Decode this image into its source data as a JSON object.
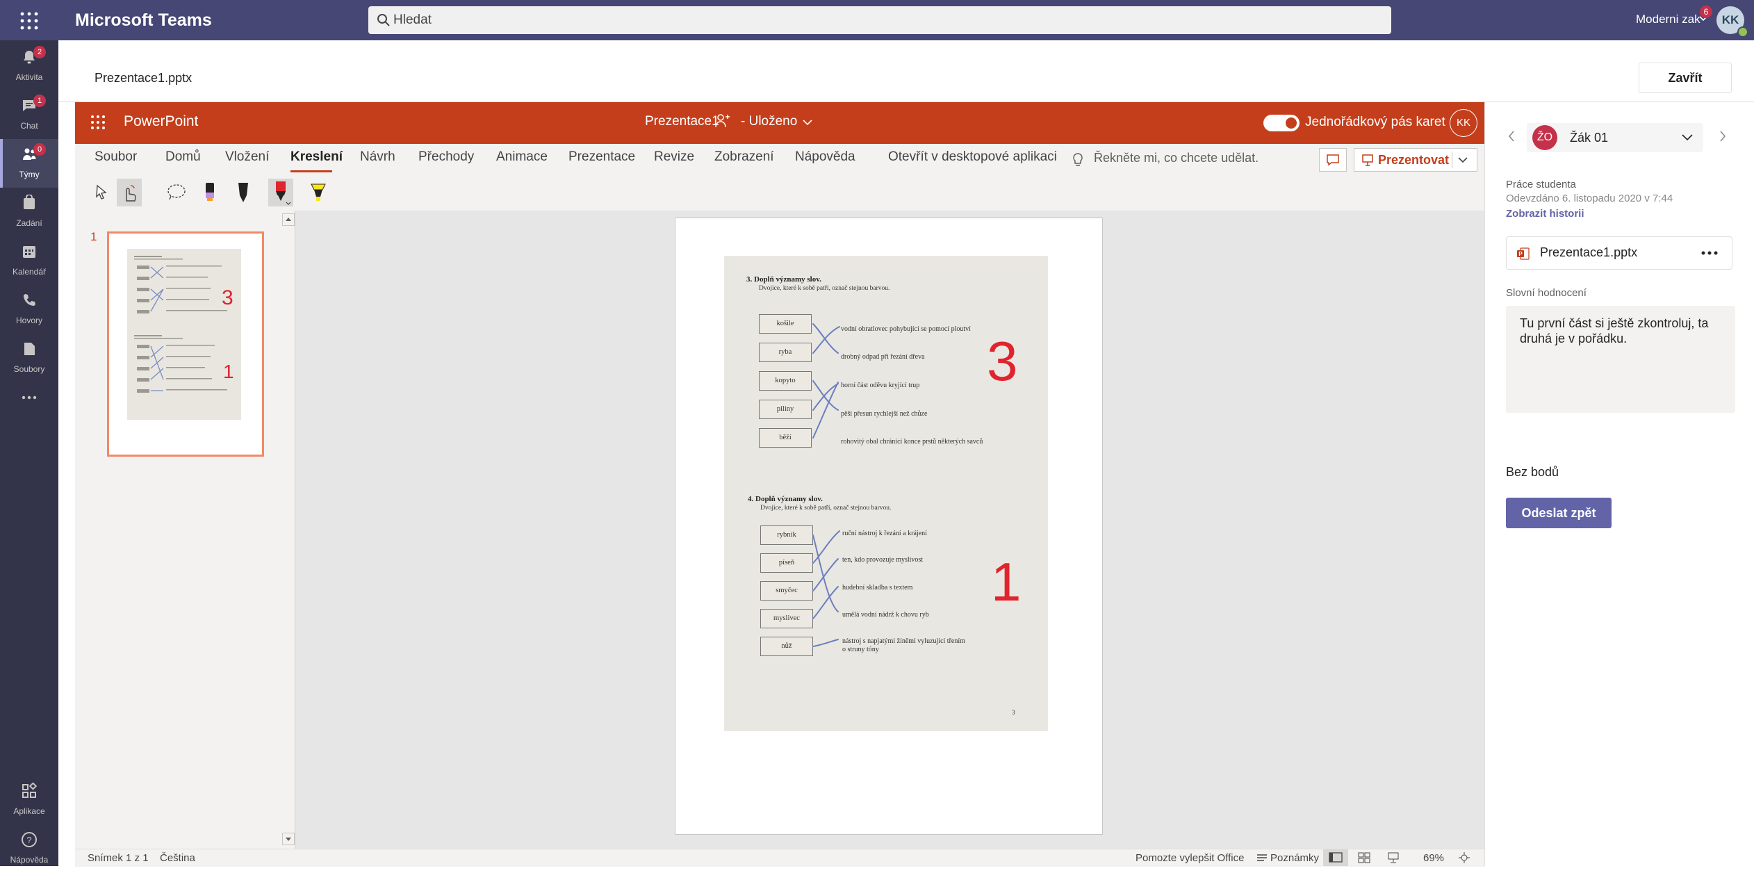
{
  "app": {
    "name": "Microsoft Teams"
  },
  "search": {
    "placeholder": "Hledat"
  },
  "user": {
    "name": "Moderni zak",
    "initials": "KK",
    "badge": "6"
  },
  "rail": [
    {
      "label": "Aktivita",
      "badge": "2",
      "icon": "bell-icon"
    },
    {
      "label": "Chat",
      "badge": "1",
      "icon": "chat-icon"
    },
    {
      "label": "Týmy",
      "badge": "0",
      "icon": "teams-icon"
    },
    {
      "label": "Zadání",
      "icon": "assignment-icon"
    },
    {
      "label": "Kalendář",
      "icon": "calendar-icon"
    },
    {
      "label": "Hovory",
      "icon": "phone-icon"
    },
    {
      "label": "Soubory",
      "icon": "files-icon"
    },
    {
      "label": "Aplikace",
      "icon": "apps-icon"
    },
    {
      "label": "Nápověda",
      "icon": "help-icon"
    }
  ],
  "content": {
    "file_title": "Prezentace1.pptx",
    "close_label": "Zavřít"
  },
  "ppt": {
    "app_name": "PowerPoint",
    "doc_title": "Prezentace1",
    "saved_status": "- Uloženo",
    "single_line_ribbon": "Jednořádkový pás karet",
    "avatar": "KK",
    "tabs": [
      "Soubor",
      "Domů",
      "Vložení",
      "Kreslení",
      "Návrh",
      "Přechody",
      "Animace",
      "Prezentace",
      "Revize",
      "Zobrazení",
      "Nápověda",
      "Otevřít v desktopové aplikaci"
    ],
    "active_tab": "Kreslení",
    "tell_me": "Řekněte mi, co chcete udělat.",
    "present_label": "Prezentovat",
    "slide_number": "1"
  },
  "slide": {
    "ex3": {
      "title": "3.  Doplň významy slov.",
      "subtitle": "Dvojice, které k sobě patří, označ stejnou barvou.",
      "words": [
        "košile",
        "ryba",
        "kopyto",
        "piliny",
        "běží"
      ],
      "defs": [
        "vodní obratlovec pohybující se pomocí ploutví",
        "drobný odpad při řezání dřeva",
        "horní část oděvu kryjící trup",
        "pěší přesun rychlejší než chůze",
        "rohovitý obal chránící konce prstů některých savců"
      ],
      "score": "3"
    },
    "ex4": {
      "title": "4.  Doplň významy slov.",
      "subtitle": "Dvojice, které k sobě patří, označ stejnou barvou.",
      "words": [
        "rybník",
        "píseň",
        "smyčec",
        "myslivec",
        "nůž"
      ],
      "defs": [
        "ruční nástroj k řezání a krájení",
        "ten, kdo provozuje myslivost",
        "hudební skladba s textem",
        "umělá vodní nádrž k chovu ryb",
        "nástroj s napjatými žíněmi vyluzující třením",
        "o struny tóny"
      ],
      "score": "1"
    },
    "page_number": "3"
  },
  "status": {
    "slide_count": "Snímek 1 z 1",
    "language": "Čeština",
    "help_improve": "Pomozte vylepšit Office",
    "notes": "Poznámky",
    "zoom": "69%"
  },
  "panel": {
    "student_initials": "ŽO",
    "student_name": "Žák 01",
    "work_label": "Práce studenta",
    "submitted": "Odevzdáno 6. listopadu 2020 v 7:44",
    "history_link": "Zobrazit historii",
    "file_name": "Prezentace1.pptx",
    "feedback_label": "Slovní hodnocení",
    "feedback_text": "Tu první část si ještě zkontroluj, ta druhá je v pořádku.",
    "points": "Bez bodů",
    "send_back": "Odeslat zpět"
  },
  "colors": {
    "teams_bar": "#464775",
    "rail": "#33344a",
    "ppt_accent": "#c43e1c",
    "teams_accent": "#6264a7",
    "ink_red": "#e0242e",
    "ink_blue": "#6a7fc0"
  }
}
